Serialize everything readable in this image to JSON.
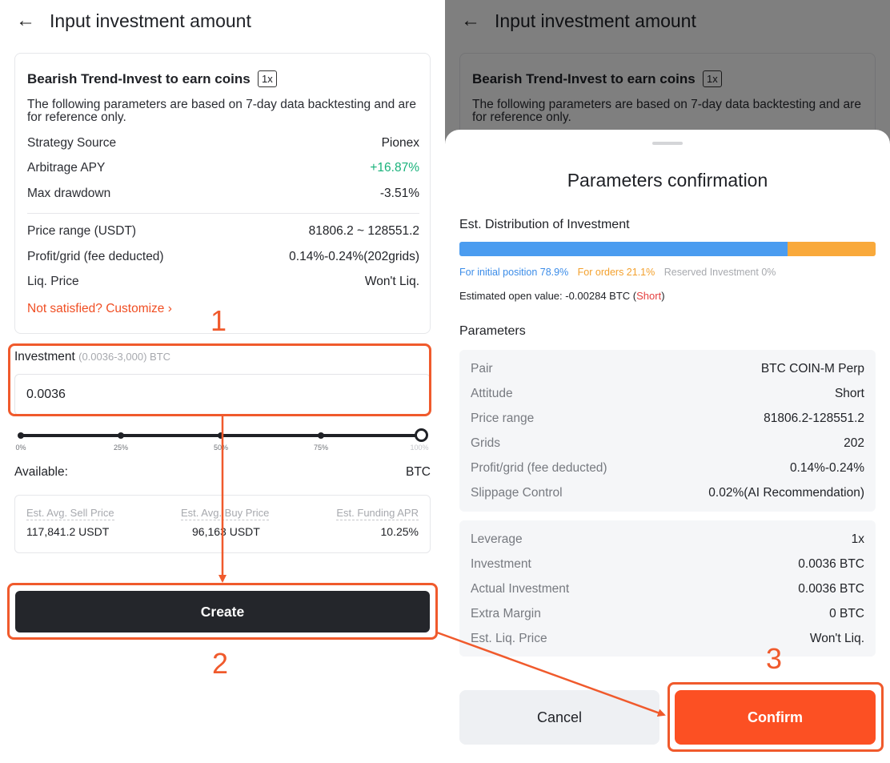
{
  "left": {
    "header_title": "Input investment amount",
    "card": {
      "title": "Bearish Trend-Invest to earn coins",
      "leverage_badge": "1x",
      "description": "The following parameters are based on 7-day data backtesting and are for reference only.",
      "rows_top": [
        {
          "label": "Strategy Source",
          "value": "Pionex"
        },
        {
          "label": "Arbitrage APY",
          "value": "+16.87%"
        },
        {
          "label": "Max drawdown",
          "value": "-3.51%"
        }
      ],
      "rows_bottom": [
        {
          "label": "Price range (USDT)",
          "value": "81806.2 ~ 128551.2"
        },
        {
          "label": "Profit/grid (fee deducted)",
          "value": "0.14%-0.24%(202grids)"
        },
        {
          "label": "Liq. Price",
          "value": "Won't Liq."
        }
      ],
      "customize_link": "Not satisfied? Customize"
    },
    "investment": {
      "label": "Investment",
      "range": "(0.0036-3,000) BTC",
      "value": "0.0036"
    },
    "slider": {
      "level_percent": 100,
      "ticks": [
        "0%",
        "25%",
        "50%",
        "75%",
        "100%"
      ]
    },
    "available": {
      "label": "Available:",
      "unit": "BTC"
    },
    "stats": [
      {
        "label": "Est. Avg. Sell Price",
        "value": "117,841.2 USDT"
      },
      {
        "label": "Est. Avg. Buy Price",
        "value": "96,163 USDT"
      },
      {
        "label": "Est. Funding APR",
        "value": "10.25%"
      }
    ],
    "create_label": "Create"
  },
  "right": {
    "sheet_title": "Parameters confirmation",
    "distribution": {
      "title": "Est. Distribution of Investment",
      "initial_position_label": "For initial position 78.9%",
      "orders_label": "For orders 21.1%",
      "reserved_label": "Reserved Investment 0%",
      "initial_position_percent": 78.9,
      "orders_percent": 21.1,
      "reserved_percent": 0
    },
    "open_value": {
      "prefix": "Estimated open value: -0.00284 BTC (",
      "side": "Short",
      "suffix": ")"
    },
    "parameters_title": "Parameters",
    "params_a": [
      {
        "label": "Pair",
        "value": "BTC COIN-M Perp"
      },
      {
        "label": "Attitude",
        "value": "Short"
      },
      {
        "label": "Price range",
        "value": "81806.2-128551.2"
      },
      {
        "label": "Grids",
        "value": "202"
      },
      {
        "label": "Profit/grid (fee deducted)",
        "value": "0.14%-0.24%"
      },
      {
        "label": "Slippage Control",
        "value": "0.02%(AI Recommendation)"
      }
    ],
    "params_b": [
      {
        "label": "Leverage",
        "value": "1x"
      },
      {
        "label": "Investment",
        "value": "0.0036 BTC"
      },
      {
        "label": "Actual Investment",
        "value": "0.0036 BTC"
      },
      {
        "label": "Extra Margin",
        "value": "0 BTC"
      },
      {
        "label": "Est. Liq. Price",
        "value": "Won't Liq."
      }
    ],
    "cancel_label": "Cancel",
    "confirm_label": "Confirm"
  },
  "annotations": {
    "step1": "1",
    "step2": "2",
    "step3": "3"
  },
  "colors": {
    "accent": "#f05a2c",
    "confirm": "#fc5023",
    "create": "#24262b",
    "positive": "#19b27b",
    "initial_position": "#4a9cf0",
    "orders": "#f9a93b",
    "short": "#e5403f"
  },
  "icons": {
    "back": "arrow-left-icon",
    "customize": "chevron-right-icon"
  }
}
